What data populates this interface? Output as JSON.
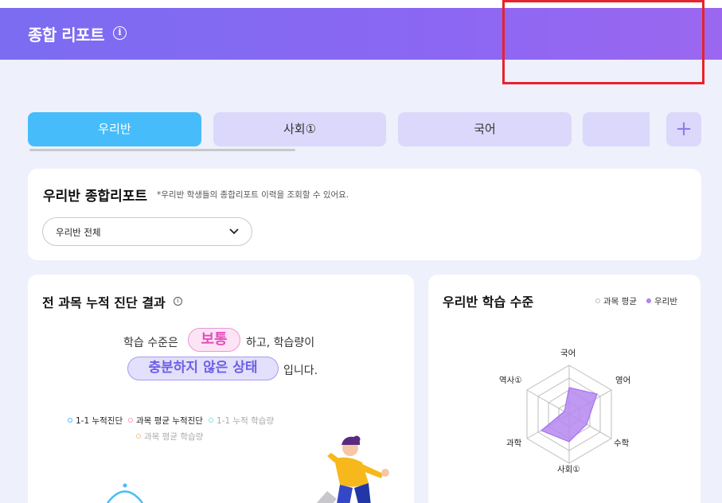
{
  "header": {
    "title": "종합 리포트",
    "info_glyph": "i"
  },
  "tabs": [
    {
      "label": "우리반",
      "active": true
    },
    {
      "label": "사회①",
      "active": false
    },
    {
      "label": "국어",
      "active": false
    },
    {
      "label": "",
      "active": false
    }
  ],
  "add_tab_label": "+",
  "summary_card": {
    "title": "우리반 종합리포트",
    "note": "*우리반 학생들의 종합리포트 이력을 조회할 수 있어요.",
    "select_value": "우리반 전체"
  },
  "diagnosis_card": {
    "title": "전 과목 누적 진단 결과",
    "sentence_part1": "학습 수준은",
    "level_badge": "보통",
    "sentence_part2": "하고, 학습량이",
    "amount_badge": "충분하지 않은 상태",
    "sentence_part3": "입니다.",
    "legend": [
      {
        "label": "1-1 누적진단",
        "color": "#46bdfa",
        "faded": false
      },
      {
        "label": "과목 평균 누적진단",
        "color": "#f6a3b4",
        "faded": false
      },
      {
        "label": "1-1 누적 학습량",
        "color": "#7fe0d6",
        "faded": true
      },
      {
        "label": "과목 평균 학습량",
        "color": "#f8c08f",
        "faded": true
      }
    ]
  },
  "level_card": {
    "title": "우리반 학습 수준",
    "legend": [
      {
        "label": "과목 평균",
        "color": "#bbbbbb"
      },
      {
        "label": "우리반",
        "color": "#a873ee"
      }
    ],
    "axes": [
      "국어",
      "영어",
      "수학",
      "사회①",
      "과학",
      "역사①"
    ]
  },
  "colors": {
    "accent": "#7b6cf1",
    "tab_active": "#46bdfa",
    "tab_inactive": "#dcd8fb",
    "radar_fill": "#b587f0"
  }
}
